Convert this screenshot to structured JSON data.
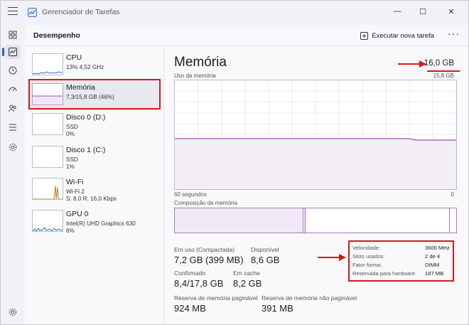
{
  "window": {
    "title": "Gerenciador de Tarefas",
    "controls": {
      "minimize": "—",
      "maximize": "☐",
      "close": "✕"
    }
  },
  "header": {
    "title": "Desempenho",
    "run_task_label": "Executar nova tarefa",
    "more_label": "···"
  },
  "rail": {
    "items": [
      "processes-icon",
      "performance-icon",
      "history-icon",
      "startup-icon",
      "users-icon",
      "details-icon",
      "services-icon"
    ],
    "settings": "settings-icon"
  },
  "perf_list": [
    {
      "name": "CPU",
      "line1": "13% 4,52 GHz",
      "line2": ""
    },
    {
      "name": "Memória",
      "line1": "7,3/15,8 GB (46%)",
      "line2": ""
    },
    {
      "name": "Disco 0 (D:)",
      "line1": "SSD",
      "line2": "0%"
    },
    {
      "name": "Disco 1 (C:)",
      "line1": "SSD",
      "line2": "1%"
    },
    {
      "name": "Wi-Fi",
      "line1": "Wi-Fi 2",
      "line2": "S: 8,0 R: 16,0 Kbps"
    },
    {
      "name": "GPU 0",
      "line1": "Intel(R) UHD Graphics 630",
      "line2": "6%"
    }
  ],
  "detail": {
    "title": "Memória",
    "total": "16,0 GB",
    "usage_label": "Uso da memória",
    "usage_max": "15,8 GB",
    "axis_left": "60 segundos",
    "axis_right": "0",
    "composition_label": "Composição da memória",
    "usage_fraction": 0.46,
    "stats": {
      "in_use_label": "Em uso (Compactada)",
      "in_use_value": "7,2 GB (399 MB)",
      "available_label": "Disponível",
      "available_value": "8,6 GB",
      "committed_label": "Confirmado",
      "committed_value": "8,4/17,8 GB",
      "cached_label": "Em cache",
      "cached_value": "8,2 GB",
      "paged_label": "Reserva de memória paginável",
      "paged_value": "924 MB",
      "nonpaged_label": "Reserva de memória não paginável",
      "nonpaged_value": "391 MB"
    },
    "specs": [
      {
        "key": "Velocidade:",
        "value": "3600 MHz"
      },
      {
        "key": "Slots usados:",
        "value": "2 de 4"
      },
      {
        "key": "Fator forma:",
        "value": "DIMM"
      },
      {
        "key": "Reservada para hardware:",
        "value": "187 MB"
      }
    ]
  },
  "colors": {
    "accent": "#2b5fd0",
    "memory_line": "#9a4fb3",
    "annotation": "#d01c1c"
  }
}
